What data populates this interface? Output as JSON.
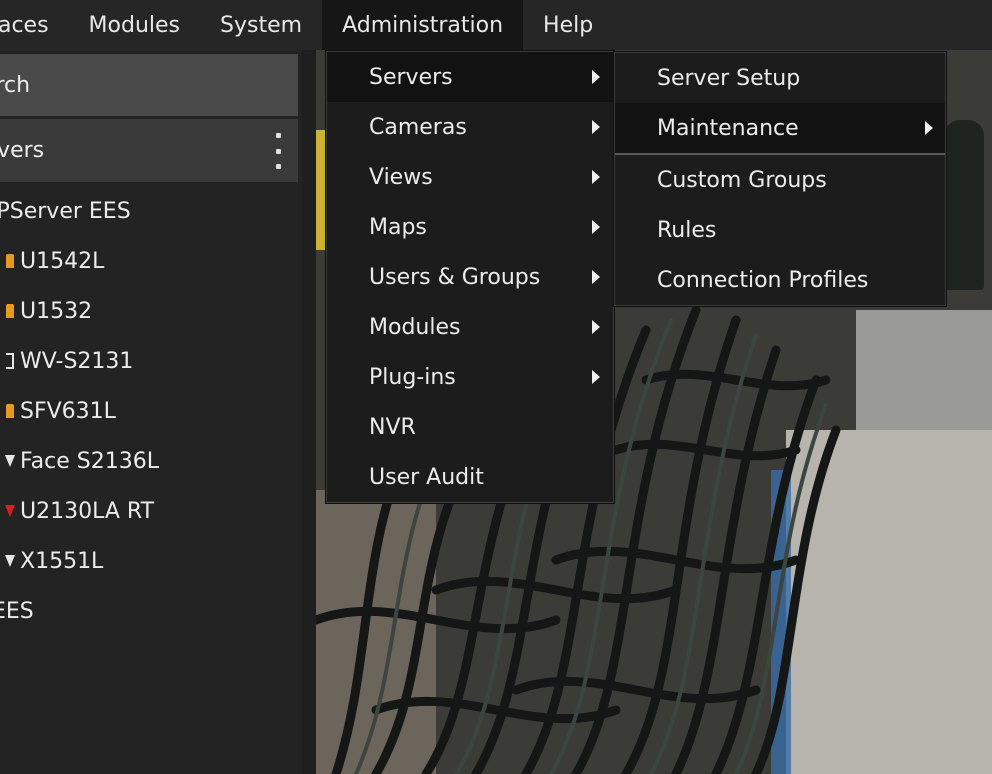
{
  "menubar": {
    "items": [
      "Spaces",
      "Modules",
      "System",
      "Administration",
      "Help"
    ],
    "first_visible": "paces",
    "active": "Administration"
  },
  "left_panel": {
    "search_placeholder": "arch",
    "section_header": "rvers",
    "more_icon": "kebab-vertical-icon",
    "tree": [
      {
        "label": "IPServer EES",
        "type": "server",
        "icon": ""
      },
      {
        "label": "U1542L",
        "type": "camera",
        "icon": "camera-orange-icon"
      },
      {
        "label": "U1532",
        "type": "camera",
        "icon": "camera-orange-icon"
      },
      {
        "label": "WV-S2131",
        "type": "camera",
        "icon": "camera-bracket-icon"
      },
      {
        "label": "SFV631L",
        "type": "camera",
        "icon": "camera-orange-icon"
      },
      {
        "label": "Face S2136L",
        "type": "camera",
        "icon": "camera-white-icon"
      },
      {
        "label": "U2130LA RT",
        "type": "camera",
        "icon": "camera-red-icon"
      },
      {
        "label": "X1551L",
        "type": "camera",
        "icon": "camera-white-icon"
      },
      {
        "label": "EES",
        "type": "group",
        "icon": ""
      }
    ]
  },
  "admin_menu": {
    "items": [
      {
        "label": "Servers",
        "submenu": true,
        "highlighted": true
      },
      {
        "label": "Cameras",
        "submenu": true
      },
      {
        "label": "Views",
        "submenu": true
      },
      {
        "label": "Maps",
        "submenu": true
      },
      {
        "label": "Users & Groups",
        "submenu": true
      },
      {
        "label": "Modules",
        "submenu": true
      },
      {
        "label": "Plug-ins",
        "submenu": true
      },
      {
        "label": "NVR",
        "submenu": false
      },
      {
        "label": "User Audit",
        "submenu": false
      }
    ]
  },
  "servers_submenu": {
    "items": [
      {
        "label": "Server Setup",
        "submenu": false
      },
      {
        "label": "Maintenance",
        "submenu": true,
        "highlighted": true
      },
      {
        "label": "Custom Groups",
        "submenu": false
      },
      {
        "label": "Rules",
        "submenu": false
      },
      {
        "label": "Connection Profiles",
        "submenu": false
      }
    ]
  },
  "colors": {
    "menubar_bg": "#262626",
    "menu_bg": "#1c1c1c",
    "highlight_bg": "#121212",
    "search_bg": "#4a4a4a",
    "header_bg": "#3a3a3a",
    "camera_orange": "#e89a1c",
    "camera_red": "#d32222"
  }
}
